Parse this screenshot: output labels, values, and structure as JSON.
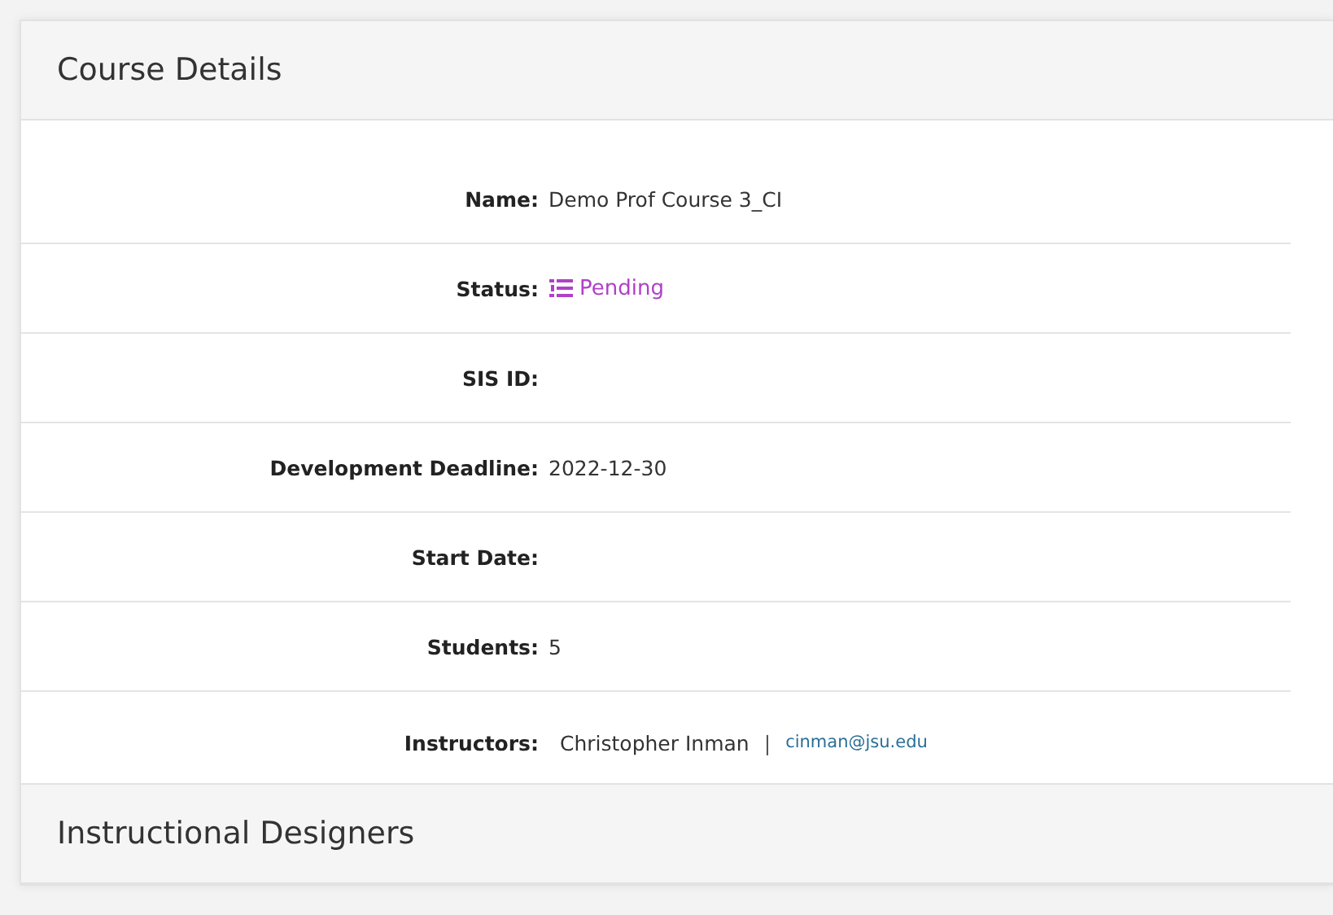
{
  "panel": {
    "title": "Course Details"
  },
  "fields": [
    {
      "label": "Name:",
      "kind": "text",
      "value": "Demo Prof Course 3_CI"
    },
    {
      "label": "Status:",
      "kind": "status",
      "value": "Pending",
      "color": "#b040c8"
    },
    {
      "label": "SIS ID:",
      "kind": "text"
    },
    {
      "label": "Development Deadline:",
      "kind": "text",
      "value": "2022-12-30"
    },
    {
      "label": "Start Date:",
      "kind": "text"
    },
    {
      "label": "Students:",
      "kind": "text",
      "value": "5"
    },
    {
      "label": "Instructors:",
      "kind": "instructor",
      "name": "Christopher Inman",
      "separator": "|",
      "email": "cinman@jsu.edu"
    }
  ],
  "next_panel": {
    "title": "Instructional Designers"
  }
}
